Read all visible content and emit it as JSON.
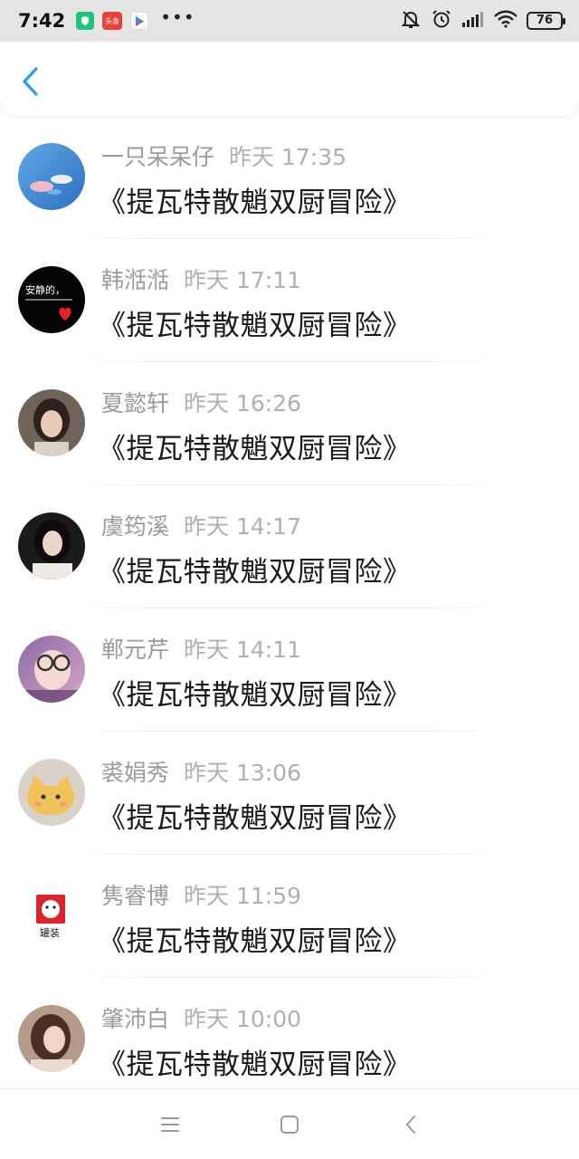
{
  "status_bar": {
    "time": "7:42",
    "app_badges": [
      "green-shield-app-icon",
      "toutiao-app-icon",
      "play-store-icon"
    ],
    "toutiao_label": "头条",
    "more_indicator": "•••",
    "battery": "76"
  },
  "header": {
    "back_icon": "chevron-left-icon",
    "accent_color": "#2a9ee8"
  },
  "messages": [
    {
      "name": "一只呆呆仔",
      "time": "昨天 17:35",
      "text": "《提瓦特散魈双厨冒险》"
    },
    {
      "name": "韩湉湉",
      "time": "昨天 17:11",
      "text": "《提瓦特散魈双厨冒险》"
    },
    {
      "name": "夏懿轩",
      "time": "昨天 16:26",
      "text": "《提瓦特散魈双厨冒险》"
    },
    {
      "name": "虞筠溪",
      "time": "昨天 14:17",
      "text": "《提瓦特散魈双厨冒险》"
    },
    {
      "name": "郸元芹",
      "time": "昨天 14:11",
      "text": "《提瓦特散魈双厨冒险》"
    },
    {
      "name": "裘娟秀",
      "time": "昨天 13:06",
      "text": "《提瓦特散魈双厨冒险》"
    },
    {
      "name": "隽睿博",
      "time": "昨天 11:59",
      "text": "《提瓦特散魈双厨冒险》"
    },
    {
      "name": "肇沛白",
      "time": "昨天 10:00",
      "text": "《提瓦特散魈双厨冒险》"
    }
  ],
  "avatar_texts": {
    "avatar_2": "安静的，",
    "avatar_7": "罐装"
  },
  "nav_bar": {
    "icons": [
      "menu-icon",
      "home-icon",
      "back-icon"
    ]
  }
}
